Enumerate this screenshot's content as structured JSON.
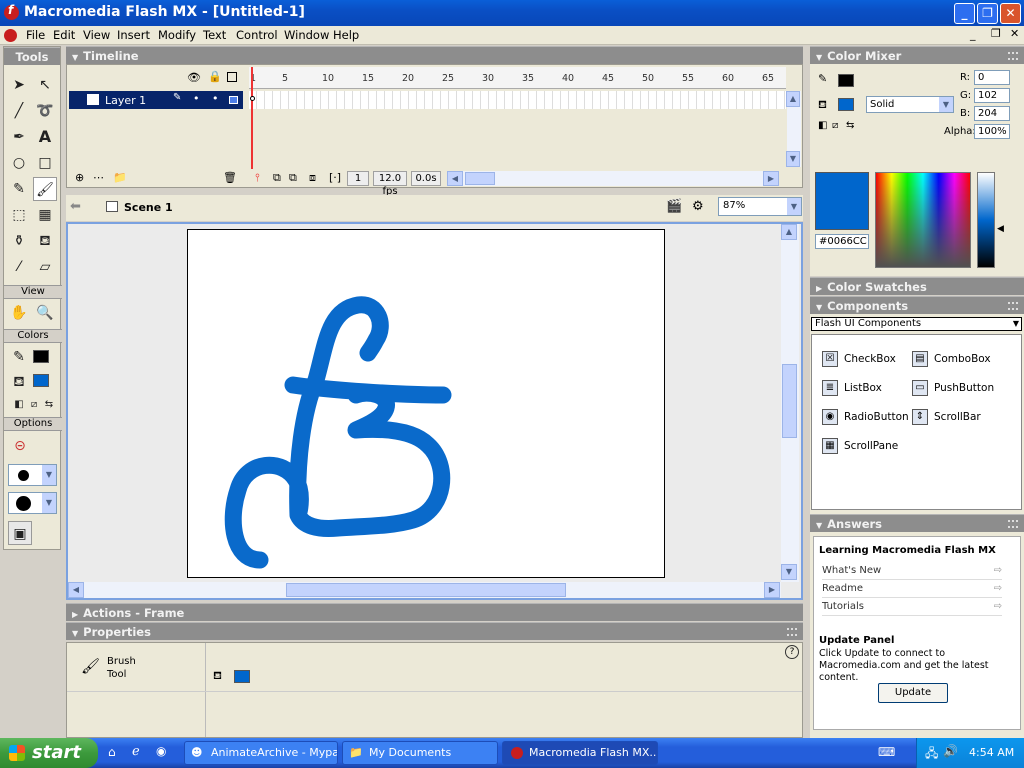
{
  "window": {
    "title": "Macromedia Flash MX - [Untitled-1]",
    "buttons": [
      "minimize",
      "restore",
      "close"
    ]
  },
  "menu": [
    "File",
    "Edit",
    "View",
    "Insert",
    "Modify",
    "Text",
    "Control",
    "Window",
    "Help"
  ],
  "tools": {
    "header": "Tools",
    "view_label": "View",
    "colors_label": "Colors",
    "options_label": "Options",
    "stroke_color": "#000000",
    "fill_color": "#0066CC"
  },
  "timeline": {
    "header": "Timeline",
    "layer_name": "Layer 1",
    "frame_numbers": [
      "1",
      "5",
      "10",
      "15",
      "20",
      "25",
      "30",
      "35",
      "40",
      "45",
      "50",
      "55",
      "60",
      "65"
    ],
    "current_frame": "1",
    "frame_rate": "12.0 fps",
    "elapsed_time": "0.0s"
  },
  "scene": {
    "name": "Scene 1",
    "zoom": "87%"
  },
  "panels": {
    "actions": "Actions - Frame",
    "properties": "Properties",
    "tool_name_line1": "Brush",
    "tool_name_line2": "Tool"
  },
  "color_mixer": {
    "header": "Color Mixer",
    "fill_type": "Solid",
    "r_label": "R:",
    "r": "0",
    "g_label": "G:",
    "g": "102",
    "b_label": "B:",
    "b": "204",
    "alpha_label": "Alpha:",
    "alpha": "100%",
    "hex": "#0066CC"
  },
  "swatches": {
    "header": "Color Swatches"
  },
  "components": {
    "header": "Components",
    "set": "Flash UI Components",
    "items": [
      "CheckBox",
      "ComboBox",
      "ListBox",
      "PushButton",
      "RadioButton",
      "ScrollBar",
      "ScrollPane"
    ]
  },
  "answers": {
    "header": "Answers",
    "title": "Learning Macromedia Flash MX",
    "links": [
      "What's New",
      "Readme",
      "Tutorials"
    ],
    "update_title": "Update Panel",
    "update_text": "Click Update to connect to Macromedia.com and get the latest content.",
    "update_button": "Update"
  },
  "taskbar": {
    "start": "start",
    "items": [
      "AnimateArchive - Mypal",
      "My Documents",
      "Macromedia Flash MX..."
    ],
    "clock": "4:54 AM"
  }
}
